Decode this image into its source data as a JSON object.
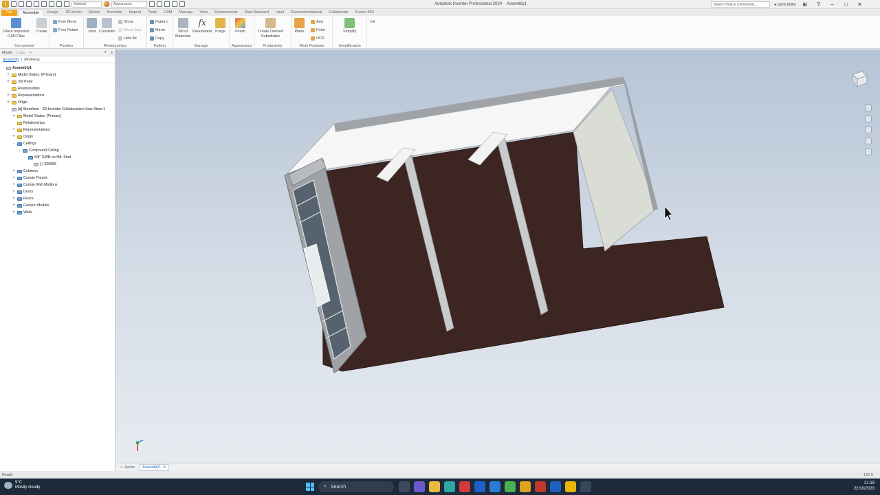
{
  "titlebar": {
    "app_title": "Autodesk Inventor Professional 2024",
    "doc_title": "Assembly1",
    "material_dropdown": "Material",
    "appearance_dropdown": "Appearance",
    "search_placeholder": "Search Help & Commands...",
    "user": "byron.botha"
  },
  "ribbon_tabs": [
    "File",
    "Assemble",
    "Design",
    "3D Model",
    "Sketch",
    "Annotate",
    "Inspect",
    "Tools",
    "CAM",
    "Manage",
    "View",
    "Environments",
    "Data Standard",
    "Vault",
    "Electromechanical",
    "Collaborate",
    "Fusion 360"
  ],
  "ribbon": {
    "component": {
      "title": "Component",
      "place_imported": "Place Imported",
      "cad_files": "CAD Files",
      "create": "Create"
    },
    "position": {
      "title": "Position",
      "free_move": "Free Move",
      "free_rotate": "Free Rotate"
    },
    "relationships": {
      "title": "Relationships",
      "joint": "Joint",
      "constrain": "Constrain",
      "show": "Show",
      "show_sick": "Show Sick",
      "hide_all": "Hide All"
    },
    "pattern": {
      "title": "Pattern",
      "pattern": "Pattern",
      "mirror": "Mirror",
      "copy": "Copy"
    },
    "manage": {
      "title": "Manage",
      "bom_1": "Bill of",
      "bom_2": "Materials",
      "parameters": "Parameters",
      "purge": "Purge"
    },
    "appearance": {
      "title": "Appearance",
      "finish": "Finish"
    },
    "productivity": {
      "title": "Productivity",
      "derived_1": "Create Derived",
      "derived_2": "Substitutes"
    },
    "work_features": {
      "title": "Work Features",
      "plane": "Plane",
      "axis": "Axis",
      "point": "Point",
      "ucs": "UCS"
    },
    "simplification": {
      "title": "Simplification",
      "simplify": "Simplify"
    }
  },
  "browser": {
    "tabs": [
      "Model",
      "Logic"
    ],
    "subtabs": [
      "Assembly",
      "Modeling"
    ],
    "tree": [
      {
        "label": "Assembly1",
        "depth": 0,
        "expander": "",
        "icon": "assembly",
        "bold": true
      },
      {
        "label": "Model States: [Primary]",
        "depth": 1,
        "expander": "+",
        "icon": "folder-yellow"
      },
      {
        "label": "3rd Party",
        "depth": 1,
        "expander": "+",
        "icon": "folder-yellow"
      },
      {
        "label": "Relationships",
        "depth": 1,
        "expander": "",
        "icon": "folder-yellow"
      },
      {
        "label": "Representations",
        "depth": 1,
        "expander": "+",
        "icon": "folder-yellow"
      },
      {
        "label": "Origin",
        "depth": 1,
        "expander": "+",
        "icon": "folder-yellow"
      },
      {
        "label": "[●] Storefront - 3D Inventor Collaboration View Store:1",
        "depth": 1,
        "expander": "-",
        "icon": "part"
      },
      {
        "label": "Model States: [Primary]",
        "depth": 2,
        "expander": "+",
        "icon": "folder-yellow"
      },
      {
        "label": "Relationships",
        "depth": 2,
        "expander": "",
        "icon": "folder-yellow"
      },
      {
        "label": "Representations",
        "depth": 2,
        "expander": "+",
        "icon": "folder-yellow"
      },
      {
        "label": "Origin",
        "depth": 2,
        "expander": "+",
        "icon": "folder-yellow"
      },
      {
        "label": "Ceilings",
        "depth": 2,
        "expander": "-",
        "icon": "folder-blue"
      },
      {
        "label": "Compound Ceiling",
        "depth": 3,
        "expander": "-",
        "icon": "folder-blue"
      },
      {
        "label": "5/8\" GWB on Mtl. Stud",
        "depth": 4,
        "expander": "-",
        "icon": "folder-blue"
      },
      {
        "label": "[-] 339955",
        "depth": 5,
        "expander": "",
        "icon": "part"
      },
      {
        "label": "Columns",
        "depth": 2,
        "expander": "+",
        "icon": "folder-blue"
      },
      {
        "label": "Curtain Panels",
        "depth": 2,
        "expander": "+",
        "icon": "folder-blue"
      },
      {
        "label": "Curtain Wall Mullions",
        "depth": 2,
        "expander": "+",
        "icon": "folder-blue"
      },
      {
        "label": "Doors",
        "depth": 2,
        "expander": "+",
        "icon": "folder-blue"
      },
      {
        "label": "Floors",
        "depth": 2,
        "expander": "+",
        "icon": "folder-blue"
      },
      {
        "label": "Generic Models",
        "depth": 2,
        "expander": "+",
        "icon": "folder-blue"
      },
      {
        "label": "Walls",
        "depth": 2,
        "expander": "+",
        "icon": "folder-blue"
      }
    ]
  },
  "doc_tabs": {
    "home": "Home",
    "assembly": "Assembly1"
  },
  "status": {
    "text": "Ready",
    "right": "125  9"
  },
  "taskbar": {
    "temperature": "9°C",
    "weather": "Mostly cloudy",
    "search": "Search",
    "time": "21:19",
    "date": "22/10/2023"
  },
  "colors": {
    "floor": "#3d2522",
    "accent_file": "#f3a21a",
    "viewport_top": "#b6c4d6",
    "taskbar": "#1c2a3b"
  }
}
